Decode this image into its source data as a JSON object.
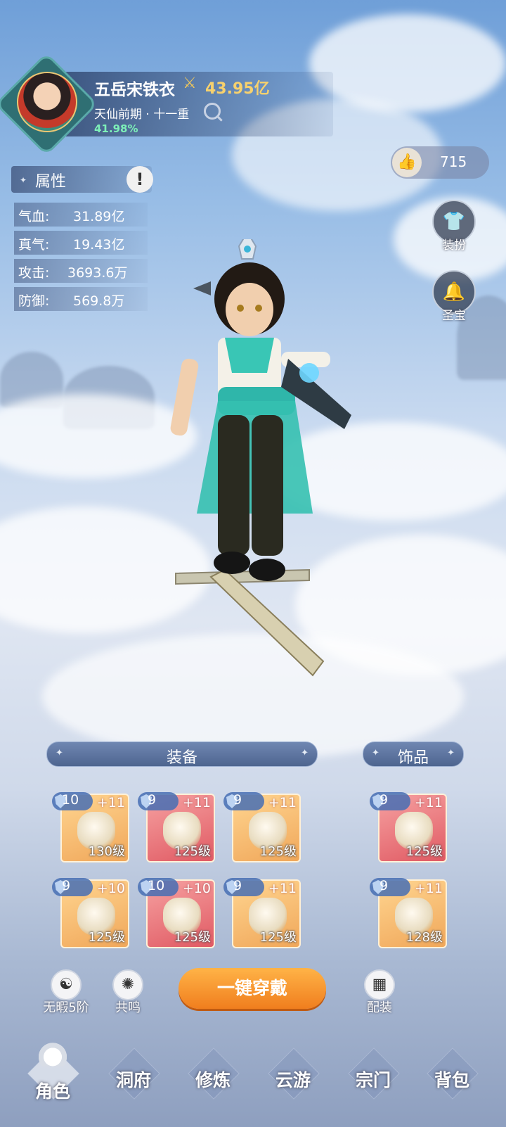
{
  "player": {
    "name": "五岳宋铁衣",
    "power": "43.95亿",
    "realm": "天仙前期 · 十一重",
    "progress": "41.98%"
  },
  "likes": {
    "count": "715"
  },
  "side_buttons": [
    {
      "label": "装扮",
      "icon": "shirt-icon"
    },
    {
      "label": "圣宝",
      "icon": "bell-icon"
    }
  ],
  "attributes": {
    "title": "属性",
    "info": "!",
    "rows": [
      {
        "label": "气血:",
        "value": "31.89亿"
      },
      {
        "label": "真气:",
        "value": "19.43亿"
      },
      {
        "label": "攻击:",
        "value": "3693.6万"
      },
      {
        "label": "防御:",
        "value": "569.8万"
      }
    ]
  },
  "equipment": {
    "title": "装备",
    "items": [
      {
        "tier": "10",
        "plus": "+11",
        "level": "130级",
        "rarity": "gold"
      },
      {
        "tier": "9",
        "plus": "+11",
        "level": "125级",
        "rarity": "red"
      },
      {
        "tier": "9",
        "plus": "+11",
        "level": "125级",
        "rarity": "gold"
      },
      {
        "tier": "9",
        "plus": "+10",
        "level": "125级",
        "rarity": "gold"
      },
      {
        "tier": "10",
        "plus": "+10",
        "level": "125级",
        "rarity": "red"
      },
      {
        "tier": "9",
        "plus": "+11",
        "level": "125级",
        "rarity": "gold"
      }
    ]
  },
  "accessories": {
    "title": "饰品",
    "items": [
      {
        "tier": "9",
        "plus": "+11",
        "level": "125级",
        "rarity": "red"
      },
      {
        "tier": "9",
        "plus": "+11",
        "level": "128级",
        "rarity": "gold"
      }
    ]
  },
  "actions": {
    "flawless": "无暇5阶",
    "resonance": "共鸣",
    "equip_all": "一键穿戴",
    "loadout": "配装"
  },
  "nav": [
    {
      "label": "角色",
      "active": true
    },
    {
      "label": "洞府"
    },
    {
      "label": "修炼"
    },
    {
      "label": "云游"
    },
    {
      "label": "宗门"
    },
    {
      "label": "背包"
    }
  ]
}
